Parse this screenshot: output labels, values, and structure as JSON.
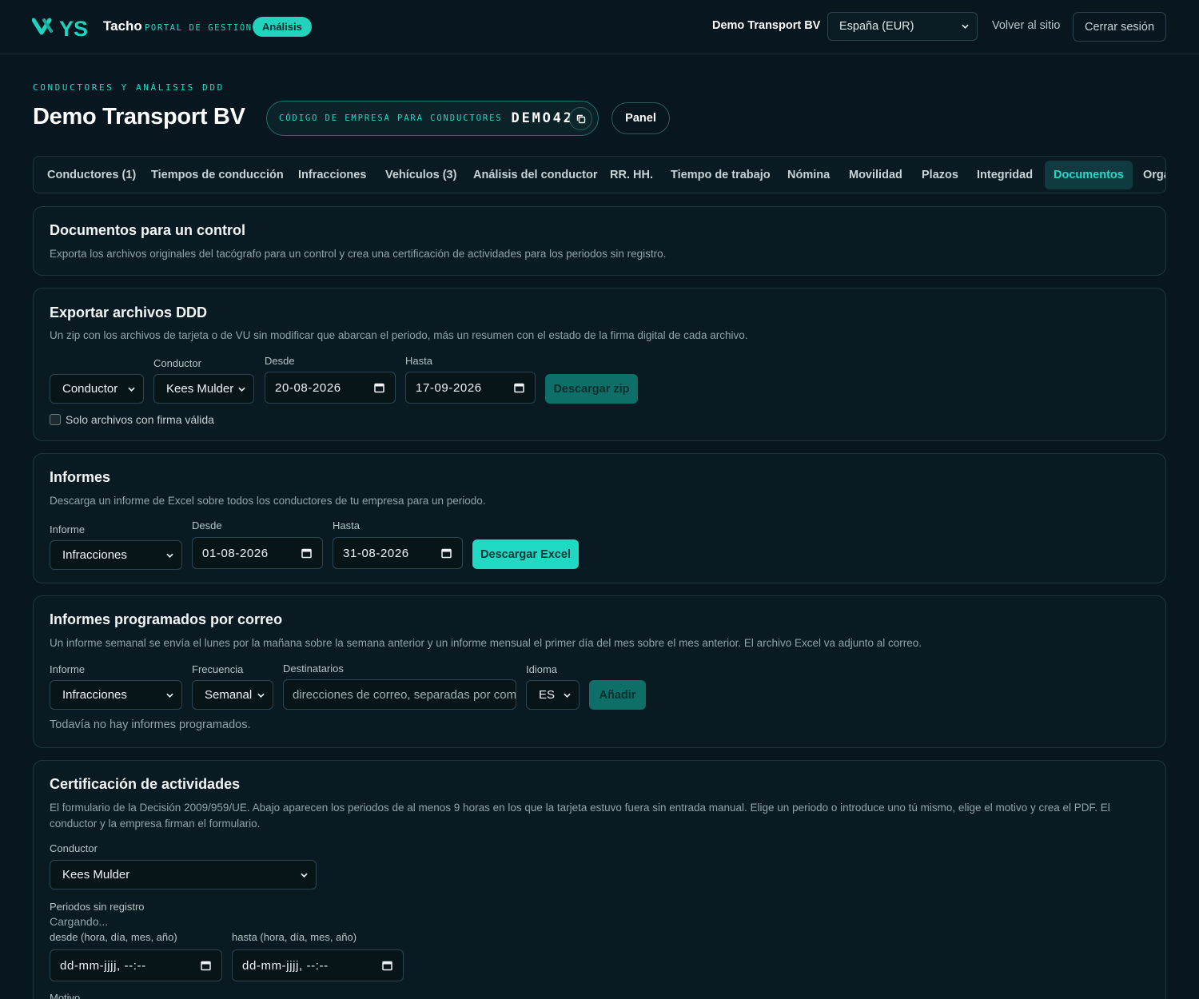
{
  "topbar": {
    "brand_logo": "YS",
    "brand_name": "Tacho",
    "brand_sub": "PORTAL DE GESTIÓN",
    "badge": "Análisis",
    "company": "Demo Transport BV",
    "country_select": "España (EUR)",
    "back_link": "Volver al sitio",
    "logout": "Cerrar sesión"
  },
  "header": {
    "eyebrow": "CONDUCTORES Y ANÁLISIS DDD",
    "title": "Demo Transport BV",
    "company_code_label": "CÓDIGO DE EMPRESA PARA CONDUCTORES",
    "company_code": "DEMO42",
    "panel_button": "Panel"
  },
  "tabs": [
    {
      "label": "Conductores (1)"
    },
    {
      "label": "Tiempos de conducción"
    },
    {
      "label": "Infracciones"
    },
    {
      "label": "Vehículos (3)"
    },
    {
      "label": "Análisis del conductor"
    },
    {
      "label": "RR. HH."
    },
    {
      "label": "Tiempo de trabajo"
    },
    {
      "label": "Nómina"
    },
    {
      "label": "Movilidad"
    },
    {
      "label": "Plazos"
    },
    {
      "label": "Integridad"
    },
    {
      "label": "Documentos",
      "active": true
    },
    {
      "label": "Orga"
    }
  ],
  "control_docs": {
    "title": "Documentos para un control",
    "desc": "Exporta los archivos originales del tacógrafo para un control y crea una certificación de actividades para los periodos sin registro."
  },
  "export_ddd": {
    "title": "Exportar archivos DDD",
    "desc": "Un zip con los archivos de tarjeta o de VU sin modificar que abarcan el periodo, más un resumen con el estado de la firma digital de cada archivo.",
    "source_select": "Conductor",
    "driver_label": "Conductor",
    "driver_select": "Kees Mulder",
    "from_label": "Desde",
    "from_value": "20-08-2026",
    "to_label": "Hasta",
    "to_value": "17-09-2026",
    "download_button": "Descargar zip",
    "checkbox_label": "Solo archivos con firma válida",
    "checkbox_checked": false
  },
  "reports": {
    "title": "Informes",
    "desc": "Descarga un informe de Excel sobre todos los conductores de tu empresa para un periodo.",
    "report_label": "Informe",
    "report_select": "Infracciones",
    "from_label": "Desde",
    "from_value": "01-08-2026",
    "to_label": "Hasta",
    "to_value": "31-08-2026",
    "download_button": "Descargar Excel"
  },
  "scheduled": {
    "title": "Informes programados por correo",
    "desc": "Un informe semanal se envía el lunes por la mañana sobre la semana anterior y un informe mensual el primer día del mes sobre el mes anterior. El archivo Excel va adjunto al correo.",
    "report_label": "Informe",
    "report_select": "Infracciones",
    "freq_label": "Frecuencia",
    "freq_select": "Semanal",
    "recipients_label": "Destinatarios",
    "recipients_placeholder": "direcciones de correo, separadas por comas",
    "lang_label": "Idioma",
    "lang_select": "ES",
    "add_button": "Añadir",
    "empty_text": "Todavía no hay informes programados."
  },
  "certification": {
    "title": "Certificación de actividades",
    "desc": "El formulario de la Decisión 2009/959/UE. Abajo aparecen los periodos de al menos 9 horas en los que la tarjeta estuvo fuera sin entrada manual. Elige un periodo o introduce uno tú mismo, elige el motivo y crea el PDF. El conductor y la empresa firman el formulario.",
    "driver_label": "Conductor",
    "driver_select": "Kees Mulder",
    "periods_label": "Periodos sin registro",
    "loading": "Cargando...",
    "from_label": "desde (hora, día, mes, año)",
    "from_placeholder": "dd-mm-jjjj, --:--",
    "to_label": "hasta (hora, día, mes, año)",
    "to_placeholder": "dd-mm-jjjj, --:--",
    "reason_label": "Motivo"
  },
  "colors": {
    "background": "#08171f",
    "card": "#0a1a22",
    "accent": "#21d9c6",
    "border": "#1d3640"
  }
}
